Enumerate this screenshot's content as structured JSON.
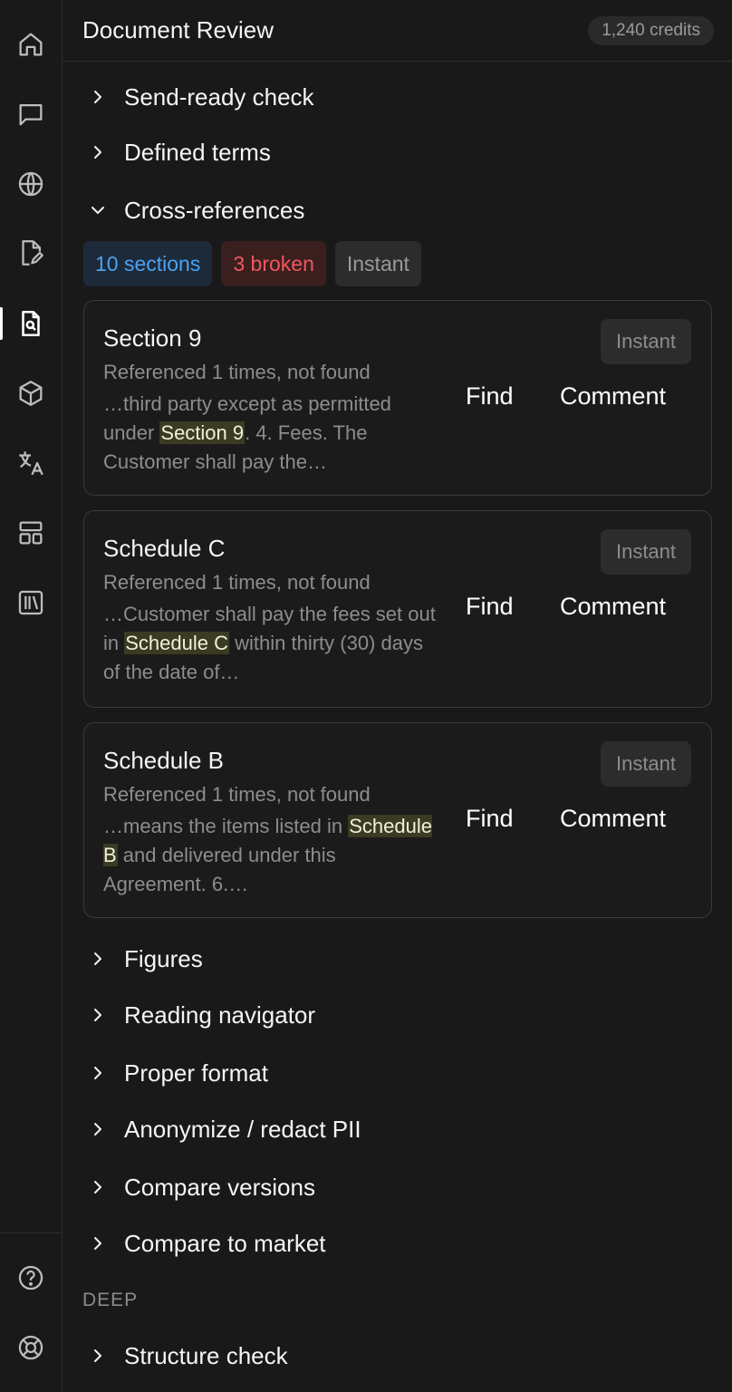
{
  "header": {
    "title": "Document Review",
    "credits": "1,240 credits"
  },
  "sidebar": {
    "items": [
      {
        "icon": "home-icon"
      },
      {
        "icon": "chat-icon"
      },
      {
        "icon": "globe-icon"
      },
      {
        "icon": "file-edit-icon"
      },
      {
        "icon": "file-search-icon",
        "active": true
      },
      {
        "icon": "box-icon"
      },
      {
        "icon": "translate-icon"
      },
      {
        "icon": "layout-icon"
      },
      {
        "icon": "library-icon"
      }
    ],
    "bottom": [
      {
        "icon": "help-icon"
      },
      {
        "icon": "lifebuoy-icon"
      }
    ]
  },
  "sections": {
    "send_ready": "Send-ready check",
    "defined_terms": "Defined terms",
    "cross_references": "Cross-references",
    "figures": "Figures",
    "reading_navigator": "Reading navigator",
    "proper_format": "Proper format",
    "anonymize": "Anonymize / redact PII",
    "compare_versions": "Compare versions",
    "compare_market": "Compare to market",
    "deep_label": "DEEP",
    "structure_check": "Structure check"
  },
  "cross_refs": {
    "chips": {
      "sections": "10 sections",
      "broken": "3 broken",
      "mode": "Instant"
    },
    "cards": [
      {
        "title": "Section 9",
        "subtitle": "Referenced 1 times, not found",
        "snippet_before": "…third party except as permitted under ",
        "highlight": "Section 9",
        "snippet_after": ". 4. Fees. The Customer shall pay the…",
        "badge": "Instant",
        "find": "Find",
        "comment": "Comment"
      },
      {
        "title": "Schedule C",
        "subtitle": "Referenced 1 times, not found",
        "snippet_before": "…Customer shall pay the fees set out in ",
        "highlight": "Schedule C",
        "snippet_after": " within thirty (30) days of the date of…",
        "badge": "Instant",
        "find": "Find",
        "comment": "Comment"
      },
      {
        "title": "Schedule B",
        "subtitle": "Referenced 1 times, not found",
        "snippet_before": "…means the items listed in ",
        "highlight": "Schedule B",
        "snippet_after": " and delivered under this Agreement. 6.…",
        "badge": "Instant",
        "find": "Find",
        "comment": "Comment"
      }
    ]
  }
}
